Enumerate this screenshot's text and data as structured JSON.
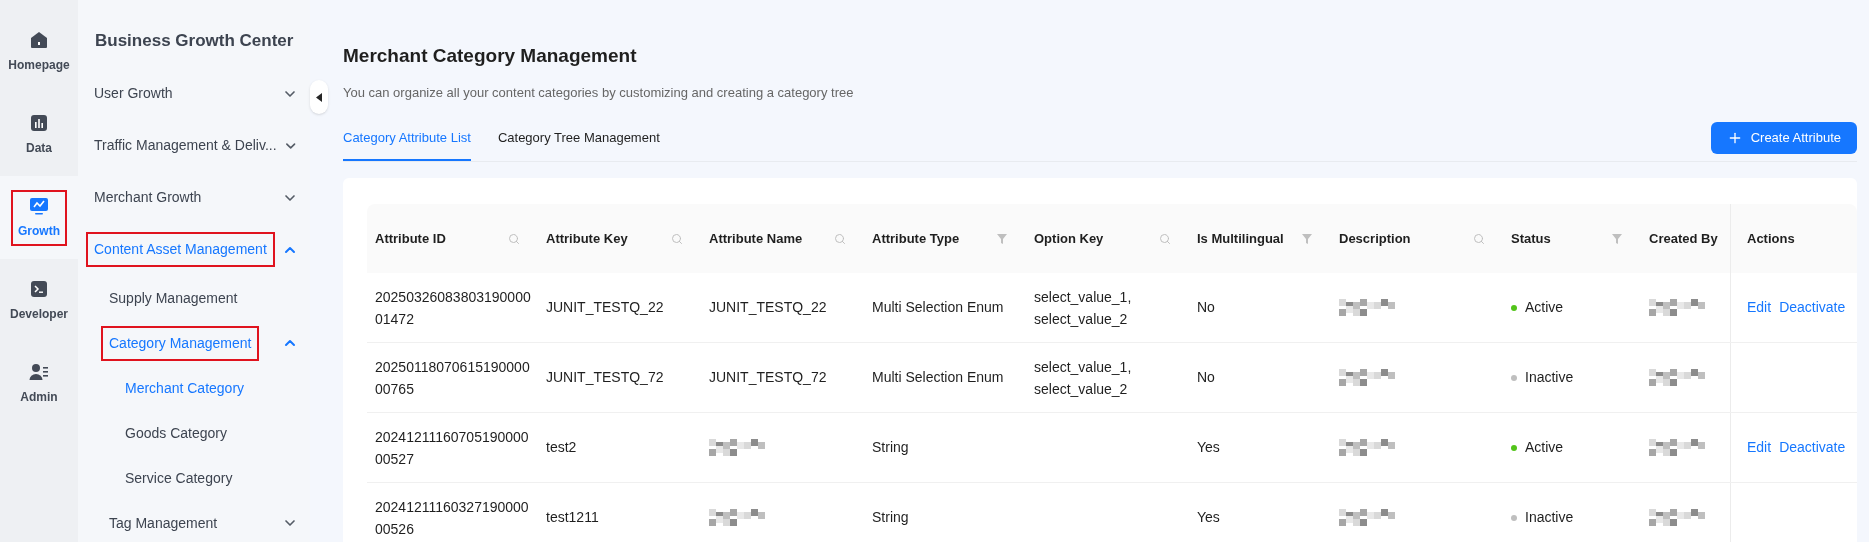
{
  "rail": {
    "items": [
      {
        "label": "Homepage",
        "kind": "home",
        "selected": false,
        "highlighted": false
      },
      {
        "label": "Data",
        "kind": "data",
        "selected": false,
        "highlighted": false
      },
      {
        "label": "Growth",
        "kind": "growth",
        "selected": true,
        "highlighted": true
      },
      {
        "label": "Developer",
        "kind": "developer",
        "selected": false,
        "highlighted": false
      },
      {
        "label": "Admin",
        "kind": "admin",
        "selected": false,
        "highlighted": false
      }
    ]
  },
  "sidebar": {
    "title": "Business Growth Center",
    "items": [
      {
        "label": "User Growth",
        "expanded": false,
        "active": false,
        "highlighted": false
      },
      {
        "label": "Traffic Management & Deliv...",
        "expanded": false,
        "active": false,
        "highlighted": false
      },
      {
        "label": "Merchant Growth",
        "expanded": false,
        "active": false,
        "highlighted": false
      },
      {
        "label": "Content Asset Management",
        "expanded": true,
        "active": true,
        "highlighted": true,
        "children": [
          {
            "label": "Supply Management",
            "active": false,
            "highlighted": false
          },
          {
            "label": "Category Management",
            "expanded": true,
            "active": true,
            "highlighted": true,
            "children": [
              {
                "label": "Merchant Category",
                "selected": true
              },
              {
                "label": "Goods Category",
                "selected": false
              },
              {
                "label": "Service Category",
                "selected": false
              }
            ]
          },
          {
            "label": "Tag Management",
            "expanded": false,
            "active": false,
            "highlighted": false
          }
        ]
      }
    ]
  },
  "page": {
    "title": "Merchant Category Management",
    "subtitle": "You can organize all your content categories by customizing and creating a category tree"
  },
  "tabs": [
    {
      "label": "Category Attribute List",
      "selected": true
    },
    {
      "label": "Category Tree Management",
      "selected": false
    }
  ],
  "create_button": {
    "label": "Create Attribute"
  },
  "table": {
    "columns": [
      {
        "label": "Attribute ID",
        "kind": "search"
      },
      {
        "label": "Attribute Key",
        "kind": "search"
      },
      {
        "label": "Attribute Name",
        "kind": "search"
      },
      {
        "label": "Attribute Type",
        "kind": "filter"
      },
      {
        "label": "Option Key",
        "kind": "search"
      },
      {
        "label": "Is Multilingual",
        "kind": "filter"
      },
      {
        "label": "Description",
        "kind": "search"
      },
      {
        "label": "Status",
        "kind": "filter"
      },
      {
        "label": "Created By",
        "kind": "plain"
      },
      {
        "label": "Actions",
        "kind": "fixed"
      }
    ],
    "rows": [
      {
        "id": [
          "20250326083803190000",
          "01472"
        ],
        "key": "JUNIT_TESTQ_22",
        "name": "JUNIT_TESTQ_22",
        "type": "Multi Selection Enum",
        "option_key": [
          "select_value_1,",
          "select_value_2"
        ],
        "multilingual": "No",
        "status": {
          "label": "Active",
          "color": "#52c41a"
        },
        "actions": [
          "Edit",
          "Deactivate"
        ]
      },
      {
        "id": [
          "20250118070615190000",
          "00765"
        ],
        "key": "JUNIT_TESTQ_72",
        "name": "JUNIT_TESTQ_72",
        "type": "Multi Selection Enum",
        "option_key": [
          "select_value_1,",
          "select_value_2"
        ],
        "multilingual": "No",
        "status": {
          "label": "Inactive",
          "color": "#bfbfbf"
        },
        "actions": []
      },
      {
        "id": [
          "20241211160705190000",
          "00527"
        ],
        "key": "test2",
        "name": {
          "redacted": true
        },
        "type": "String",
        "multilingual": "Yes",
        "status": {
          "label": "Active",
          "color": "#52c41a"
        },
        "actions": [
          "Edit",
          "Deactivate"
        ]
      },
      {
        "id": [
          "20241211160327190000",
          "00526"
        ],
        "key": "test1211",
        "name": {
          "redacted": true
        },
        "type": "String",
        "multilingual": "Yes",
        "status": {
          "label": "Inactive",
          "color": "#bfbfbf"
        },
        "actions": []
      }
    ]
  }
}
